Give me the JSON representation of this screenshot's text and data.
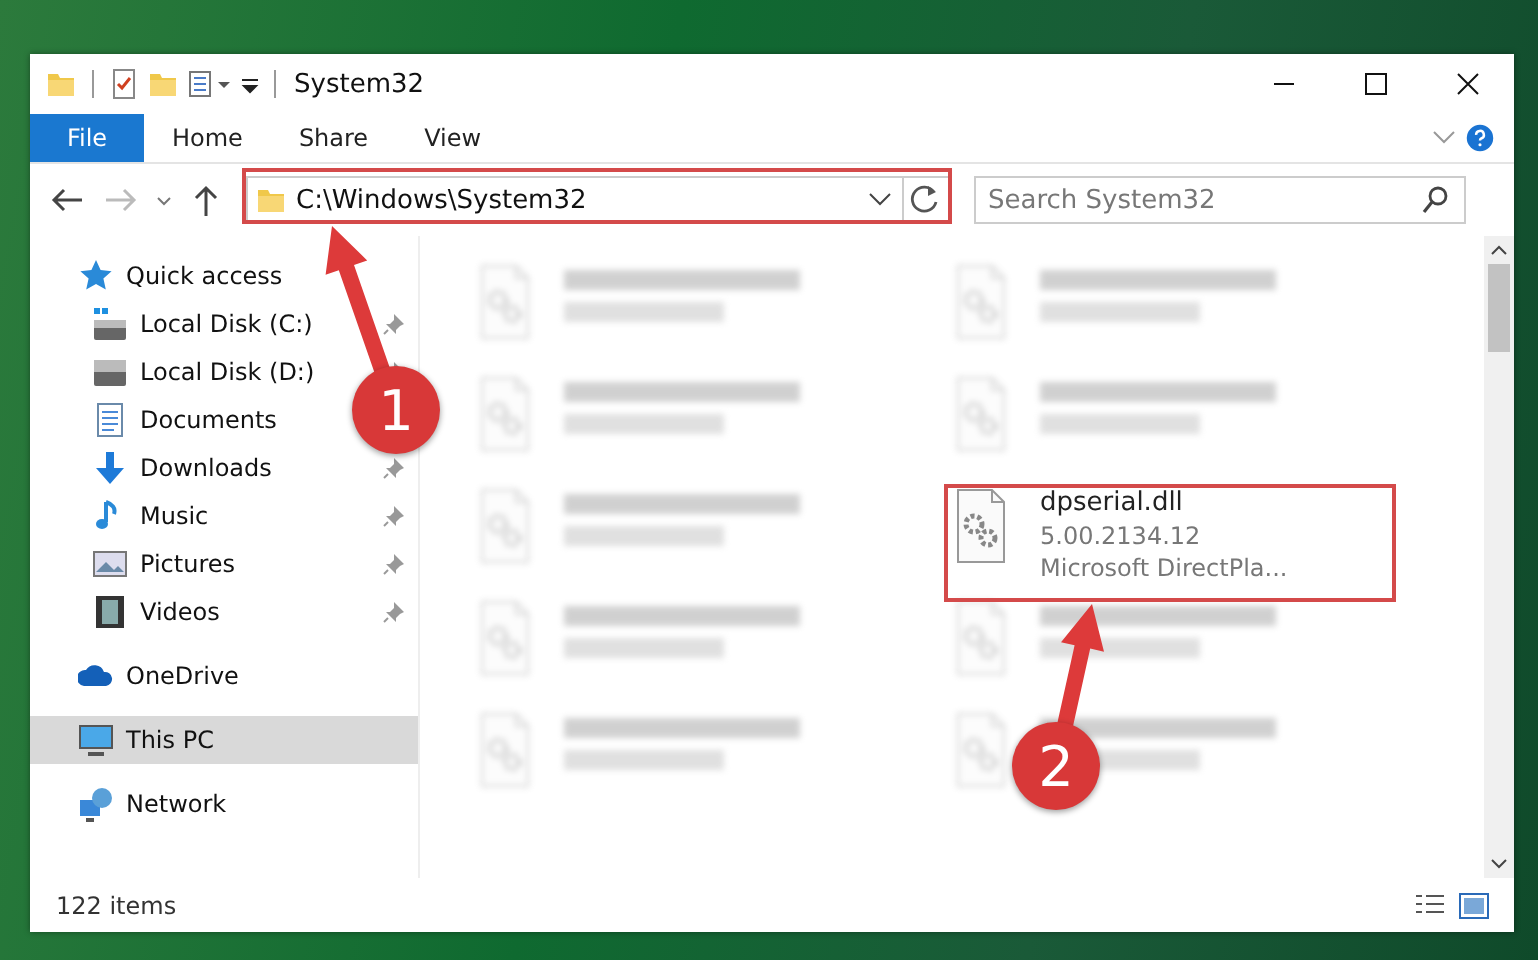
{
  "window": {
    "title": "System32"
  },
  "ribbon_tabs": [
    {
      "label": "File",
      "selected": true
    },
    {
      "label": "Home",
      "selected": false
    },
    {
      "label": "Share",
      "selected": false
    },
    {
      "label": "View",
      "selected": false
    }
  ],
  "address": {
    "path": "C:\\Windows\\System32"
  },
  "search": {
    "placeholder": "Search System32"
  },
  "sidebar": {
    "items": [
      {
        "label": "Quick access",
        "kind": "star",
        "pinned": false,
        "selected": false,
        "children": [
          {
            "label": "Local Disk (C:)",
            "kind": "disk-c",
            "pinned": true,
            "selected": false
          },
          {
            "label": "Local Disk (D:)",
            "kind": "disk",
            "pinned": true,
            "selected": false
          },
          {
            "label": "Documents",
            "kind": "doc",
            "pinned": false,
            "selected": false
          },
          {
            "label": "Downloads",
            "kind": "download",
            "pinned": true,
            "selected": false
          },
          {
            "label": "Music",
            "kind": "music",
            "pinned": true,
            "selected": false
          },
          {
            "label": "Pictures",
            "kind": "pictures",
            "pinned": true,
            "selected": false
          },
          {
            "label": "Videos",
            "kind": "videos",
            "pinned": true,
            "selected": false
          }
        ]
      },
      {
        "label": "OneDrive",
        "kind": "cloud",
        "pinned": false,
        "selected": false
      },
      {
        "label": "This PC",
        "kind": "pc",
        "pinned": false,
        "selected": true
      },
      {
        "label": "Network",
        "kind": "network",
        "pinned": false,
        "selected": false
      }
    ]
  },
  "files": [
    {
      "blurred": true
    },
    {
      "blurred": true
    },
    {
      "blurred": true
    },
    {
      "blurred": true
    },
    {
      "blurred": true
    },
    {
      "name": "dpserial.dll",
      "lines": [
        "5.00.2134.12",
        "Microsoft DirectPla..."
      ],
      "blurred": false
    },
    {
      "blurred": true
    },
    {
      "blurred": true
    },
    {
      "blurred": true
    },
    {
      "blurred": true
    }
  ],
  "status_bar": {
    "count": "122 items"
  },
  "annotations": [
    {
      "label": "1"
    },
    {
      "label": "2"
    }
  ]
}
